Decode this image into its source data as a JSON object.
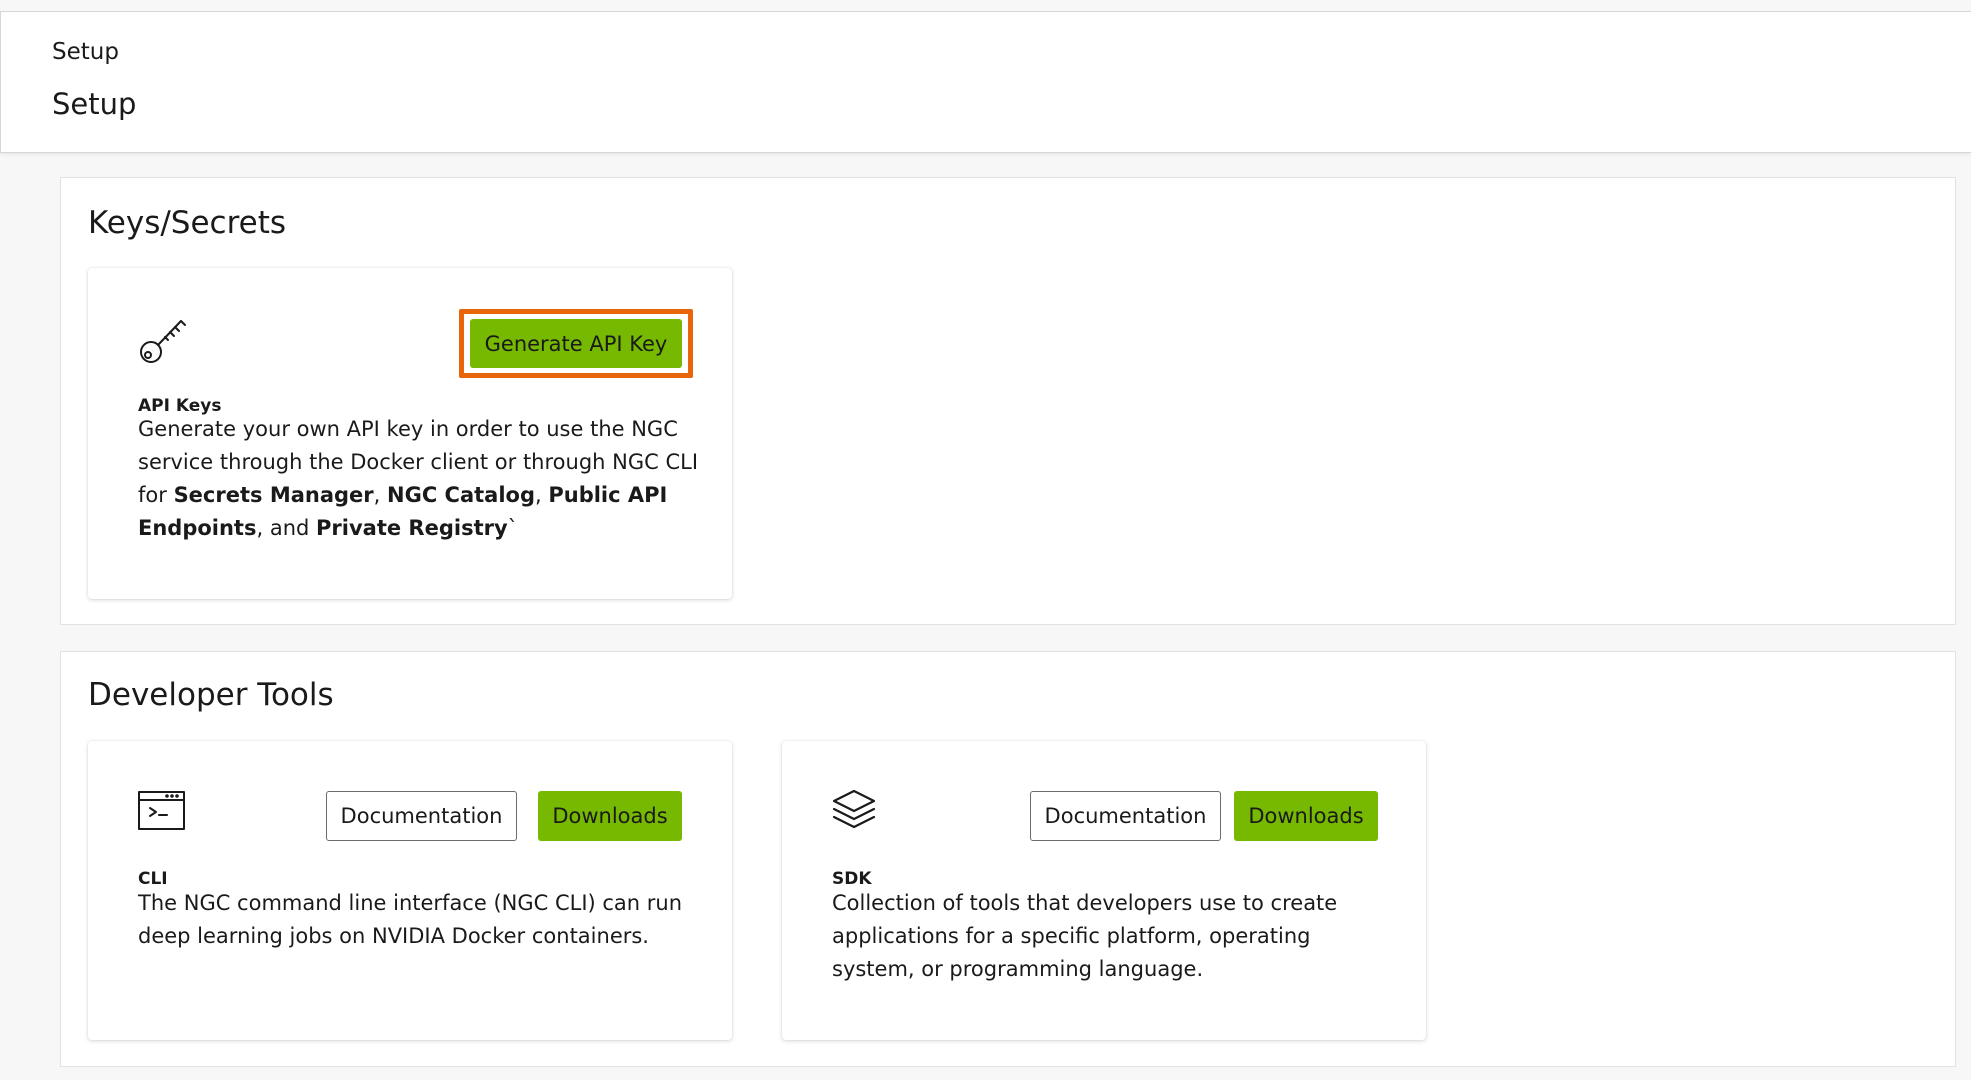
{
  "header": {
    "breadcrumb": "Setup",
    "title": "Setup"
  },
  "keys_section": {
    "title": "Keys/Secrets",
    "api_card": {
      "icon": "key-icon",
      "button_label": "Generate API Key",
      "label": "API Keys",
      "desc_1": "Generate your own API key in order to use the NGC service through the Docker client or through NGC CLI for ",
      "bold_1": "Secrets Manager",
      "sep_1": ", ",
      "bold_2": "NGC Catalog",
      "sep_2": ", ",
      "bold_3": "Public API Endpoints",
      "sep_3": ", and ",
      "bold_4": "Private Registry",
      "desc_end": "`"
    }
  },
  "dev_section": {
    "title": "Developer Tools",
    "cli_card": {
      "icon": "terminal-icon",
      "doc_label": "Documentation",
      "download_label": "Downloads",
      "label": "CLI",
      "desc": "The NGC command line interface (NGC CLI) can run deep learning jobs on NVIDIA Docker containers."
    },
    "sdk_card": {
      "icon": "layers-icon",
      "doc_label": "Documentation",
      "download_label": "Downloads",
      "label": "SDK",
      "desc": "Collection of tools that developers use to create applications for a specific platform, operating system, or programming language."
    }
  },
  "colors": {
    "accent_green": "#76b900",
    "highlight_orange": "#e8650a"
  }
}
